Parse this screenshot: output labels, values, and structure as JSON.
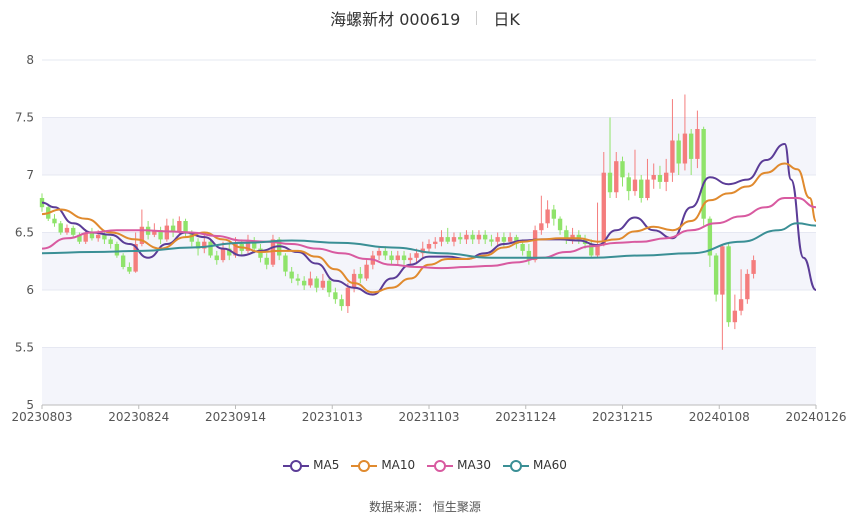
{
  "header": {
    "stock": "海螺新材 000619",
    "period": "日K"
  },
  "source": "数据来源： 恒生聚源",
  "colors": {
    "up": "#f47d7d",
    "down": "#8fe36a",
    "grid_band": "#f4f5fb",
    "ma5": "#5b3c97",
    "ma10": "#e08a2e",
    "ma30": "#d85aa0",
    "ma60": "#3a8f95"
  },
  "chart_data": {
    "type": "candlestick",
    "title": "海螺新材 000619 日K",
    "ylim": [
      5,
      8
    ],
    "y_ticks": [
      "5",
      "5.5",
      "6",
      "6.5",
      "7",
      "7.5",
      "8"
    ],
    "x_ticks": [
      "20230803",
      "20230824",
      "20230914",
      "20231013",
      "20231103",
      "20231124",
      "20231215",
      "20240108",
      "20240126"
    ],
    "trading_days": 119,
    "legend_position": "bottom",
    "series": [
      {
        "name": "MA5",
        "color": "#5b3c97",
        "points": [
          [
            0,
            6.76
          ],
          [
            2,
            6.72
          ],
          [
            5,
            6.58
          ],
          [
            8,
            6.5
          ],
          [
            11,
            6.48
          ],
          [
            14,
            6.4
          ],
          [
            17,
            6.28
          ],
          [
            20,
            6.4
          ],
          [
            23,
            6.5
          ],
          [
            26,
            6.46
          ],
          [
            29,
            6.36
          ],
          [
            32,
            6.3
          ],
          [
            35,
            6.34
          ],
          [
            38,
            6.38
          ],
          [
            41,
            6.33
          ],
          [
            44,
            6.23
          ],
          [
            47,
            6.08
          ],
          [
            50,
            6.02
          ],
          [
            53,
            5.96
          ],
          [
            56,
            6.1
          ],
          [
            59,
            6.22
          ],
          [
            62,
            6.29
          ],
          [
            65,
            6.29
          ],
          [
            68,
            6.27
          ],
          [
            71,
            6.32
          ],
          [
            74,
            6.4
          ],
          [
            77,
            6.43
          ],
          [
            80,
            6.44
          ],
          [
            83,
            6.44
          ],
          [
            86,
            6.43
          ],
          [
            89,
            6.39
          ],
          [
            92,
            6.52
          ],
          [
            95,
            6.63
          ],
          [
            98,
            6.52
          ],
          [
            101,
            6.45
          ],
          [
            104,
            6.72
          ],
          [
            107,
            6.98
          ],
          [
            110,
            6.92
          ],
          [
            113,
            6.96
          ],
          [
            116,
            7.13
          ],
          [
            119,
            7.27
          ],
          [
            120,
            6.96
          ],
          [
            122,
            6.28
          ],
          [
            124,
            6.0
          ]
        ]
      },
      {
        "name": "MA10",
        "color": "#e08a2e",
        "points": [
          [
            0,
            6.66
          ],
          [
            3,
            6.7
          ],
          [
            7,
            6.62
          ],
          [
            11,
            6.5
          ],
          [
            15,
            6.44
          ],
          [
            19,
            6.36
          ],
          [
            23,
            6.46
          ],
          [
            26,
            6.5
          ],
          [
            29,
            6.44
          ],
          [
            32,
            6.37
          ],
          [
            35,
            6.33
          ],
          [
            38,
            6.34
          ],
          [
            41,
            6.34
          ],
          [
            44,
            6.29
          ],
          [
            47,
            6.18
          ],
          [
            50,
            6.06
          ],
          [
            53,
            5.98
          ],
          [
            56,
            6.02
          ],
          [
            59,
            6.1
          ],
          [
            62,
            6.22
          ],
          [
            65,
            6.27
          ],
          [
            68,
            6.27
          ],
          [
            71,
            6.3
          ],
          [
            74,
            6.37
          ],
          [
            77,
            6.42
          ],
          [
            80,
            6.44
          ],
          [
            83,
            6.45
          ],
          [
            86,
            6.45
          ],
          [
            89,
            6.42
          ],
          [
            92,
            6.44
          ],
          [
            95,
            6.51
          ],
          [
            98,
            6.55
          ],
          [
            101,
            6.52
          ],
          [
            104,
            6.6
          ],
          [
            107,
            6.78
          ],
          [
            110,
            6.84
          ],
          [
            113,
            6.9
          ],
          [
            116,
            7.02
          ],
          [
            119,
            7.1
          ],
          [
            121,
            7.05
          ],
          [
            123,
            6.8
          ],
          [
            124,
            6.6
          ]
        ]
      },
      {
        "name": "MA30",
        "color": "#d85aa0",
        "points": [
          [
            0,
            6.36
          ],
          [
            4,
            6.45
          ],
          [
            8,
            6.5
          ],
          [
            12,
            6.52
          ],
          [
            16,
            6.52
          ],
          [
            20,
            6.51
          ],
          [
            24,
            6.5
          ],
          [
            28,
            6.47
          ],
          [
            32,
            6.43
          ],
          [
            36,
            6.42
          ],
          [
            40,
            6.4
          ],
          [
            44,
            6.36
          ],
          [
            48,
            6.32
          ],
          [
            52,
            6.27
          ],
          [
            56,
            6.22
          ],
          [
            60,
            6.2
          ],
          [
            64,
            6.19
          ],
          [
            68,
            6.2
          ],
          [
            72,
            6.21
          ],
          [
            76,
            6.24
          ],
          [
            80,
            6.28
          ],
          [
            84,
            6.33
          ],
          [
            88,
            6.38
          ],
          [
            92,
            6.41
          ],
          [
            96,
            6.42
          ],
          [
            100,
            6.45
          ],
          [
            104,
            6.52
          ],
          [
            108,
            6.58
          ],
          [
            112,
            6.64
          ],
          [
            116,
            6.72
          ],
          [
            119,
            6.8
          ],
          [
            121,
            6.8
          ],
          [
            124,
            6.72
          ]
        ]
      },
      {
        "name": "MA60",
        "color": "#3a8f95",
        "points": [
          [
            0,
            6.32
          ],
          [
            8,
            6.33
          ],
          [
            16,
            6.34
          ],
          [
            24,
            6.37
          ],
          [
            32,
            6.41
          ],
          [
            40,
            6.43
          ],
          [
            48,
            6.41
          ],
          [
            56,
            6.37
          ],
          [
            64,
            6.32
          ],
          [
            72,
            6.28
          ],
          [
            80,
            6.28
          ],
          [
            88,
            6.28
          ],
          [
            96,
            6.3
          ],
          [
            104,
            6.32
          ],
          [
            112,
            6.42
          ],
          [
            118,
            6.52
          ],
          [
            121,
            6.58
          ],
          [
            124,
            6.56
          ]
        ]
      }
    ],
    "candles": [
      [
        6.8,
        6.72,
        6.84,
        6.68
      ],
      [
        6.72,
        6.62,
        6.75,
        6.6
      ],
      [
        6.62,
        6.58,
        6.66,
        6.55
      ],
      [
        6.58,
        6.5,
        6.6,
        6.48
      ],
      [
        6.5,
        6.54,
        6.57,
        6.48
      ],
      [
        6.54,
        6.48,
        6.56,
        6.45
      ],
      [
        6.48,
        6.42,
        6.5,
        6.4
      ],
      [
        6.42,
        6.5,
        6.53,
        6.4
      ],
      [
        6.5,
        6.45,
        6.54,
        6.43
      ],
      [
        6.45,
        6.48,
        6.52,
        6.42
      ],
      [
        6.48,
        6.44,
        6.5,
        6.4
      ],
      [
        6.44,
        6.4,
        6.46,
        6.36
      ],
      [
        6.4,
        6.3,
        6.42,
        6.28
      ],
      [
        6.3,
        6.2,
        6.32,
        6.18
      ],
      [
        6.2,
        6.16,
        6.24,
        6.14
      ],
      [
        6.16,
        6.4,
        6.5,
        6.15
      ],
      [
        6.4,
        6.55,
        6.7,
        6.38
      ],
      [
        6.55,
        6.48,
        6.6,
        6.44
      ],
      [
        6.48,
        6.52,
        6.58,
        6.46
      ],
      [
        6.52,
        6.44,
        6.55,
        6.4
      ],
      [
        6.44,
        6.56,
        6.62,
        6.42
      ],
      [
        6.56,
        6.5,
        6.62,
        6.46
      ],
      [
        6.5,
        6.6,
        6.64,
        6.48
      ],
      [
        6.6,
        6.5,
        6.62,
        6.46
      ],
      [
        6.5,
        6.42,
        6.52,
        6.38
      ],
      [
        6.42,
        6.36,
        6.45,
        6.3
      ],
      [
        6.36,
        6.42,
        6.48,
        6.32
      ],
      [
        6.42,
        6.3,
        6.44,
        6.28
      ],
      [
        6.3,
        6.26,
        6.34,
        6.22
      ],
      [
        6.26,
        6.36,
        6.42,
        6.24
      ],
      [
        6.36,
        6.3,
        6.4,
        6.26
      ],
      [
        6.3,
        6.4,
        6.46,
        6.28
      ],
      [
        6.4,
        6.34,
        6.44,
        6.3
      ],
      [
        6.34,
        6.42,
        6.48,
        6.32
      ],
      [
        6.42,
        6.36,
        6.46,
        6.32
      ],
      [
        6.36,
        6.28,
        6.4,
        6.24
      ],
      [
        6.28,
        6.22,
        6.32,
        6.18
      ],
      [
        6.22,
        6.44,
        6.48,
        6.2
      ],
      [
        6.44,
        6.3,
        6.46,
        6.26
      ],
      [
        6.3,
        6.16,
        6.32,
        6.12
      ],
      [
        6.16,
        6.1,
        6.2,
        6.06
      ],
      [
        6.1,
        6.08,
        6.14,
        6.04
      ],
      [
        6.08,
        6.04,
        6.12,
        6.0
      ],
      [
        6.04,
        6.1,
        6.16,
        6.02
      ],
      [
        6.1,
        6.02,
        6.12,
        5.98
      ],
      [
        6.02,
        6.08,
        6.14,
        6.0
      ],
      [
        6.08,
        5.98,
        6.1,
        5.94
      ],
      [
        5.98,
        5.92,
        6.02,
        5.88
      ],
      [
        5.92,
        5.86,
        5.96,
        5.82
      ],
      [
        5.86,
        6.02,
        6.06,
        5.8
      ],
      [
        6.02,
        6.14,
        6.18,
        5.98
      ],
      [
        6.14,
        6.1,
        6.2,
        6.06
      ],
      [
        6.1,
        6.22,
        6.26,
        6.08
      ],
      [
        6.22,
        6.3,
        6.34,
        6.18
      ],
      [
        6.3,
        6.34,
        6.38,
        6.26
      ],
      [
        6.34,
        6.3,
        6.38,
        6.26
      ],
      [
        6.3,
        6.26,
        6.34,
        6.22
      ],
      [
        6.26,
        6.3,
        6.34,
        6.22
      ],
      [
        6.3,
        6.26,
        6.34,
        6.22
      ],
      [
        6.26,
        6.28,
        6.32,
        6.22
      ],
      [
        6.28,
        6.32,
        6.36,
        6.24
      ],
      [
        6.32,
        6.36,
        6.42,
        6.28
      ],
      [
        6.36,
        6.4,
        6.44,
        6.32
      ],
      [
        6.4,
        6.42,
        6.46,
        6.36
      ],
      [
        6.42,
        6.46,
        6.52,
        6.38
      ],
      [
        6.46,
        6.42,
        6.54,
        6.4
      ],
      [
        6.42,
        6.46,
        6.5,
        6.38
      ],
      [
        6.46,
        6.44,
        6.5,
        6.4
      ],
      [
        6.44,
        6.48,
        6.52,
        6.4
      ],
      [
        6.48,
        6.44,
        6.52,
        6.4
      ],
      [
        6.44,
        6.48,
        6.52,
        6.4
      ],
      [
        6.48,
        6.44,
        6.52,
        6.4
      ],
      [
        6.44,
        6.42,
        6.48,
        6.38
      ],
      [
        6.42,
        6.46,
        6.5,
        6.38
      ],
      [
        6.46,
        6.42,
        6.5,
        6.38
      ],
      [
        6.42,
        6.46,
        6.5,
        6.4
      ],
      [
        6.46,
        6.4,
        6.48,
        6.36
      ],
      [
        6.4,
        6.34,
        6.44,
        6.3
      ],
      [
        6.34,
        6.26,
        6.4,
        6.22
      ],
      [
        6.26,
        6.52,
        6.56,
        6.24
      ],
      [
        6.52,
        6.58,
        6.82,
        6.48
      ],
      [
        6.58,
        6.7,
        6.78,
        6.54
      ],
      [
        6.7,
        6.62,
        6.74,
        6.56
      ],
      [
        6.62,
        6.52,
        6.64,
        6.48
      ],
      [
        6.52,
        6.44,
        6.56,
        6.4
      ],
      [
        6.44,
        6.48,
        6.54,
        6.4
      ],
      [
        6.48,
        6.44,
        6.52,
        6.4
      ],
      [
        6.44,
        6.4,
        6.48,
        6.36
      ],
      [
        6.4,
        6.3,
        6.44,
        6.28
      ],
      [
        6.3,
        6.4,
        6.76,
        6.28
      ],
      [
        6.4,
        7.02,
        7.2,
        6.38
      ],
      [
        7.02,
        6.85,
        7.5,
        6.8
      ],
      [
        6.85,
        7.12,
        7.2,
        6.8
      ],
      [
        7.12,
        6.98,
        7.16,
        6.9
      ],
      [
        6.98,
        6.86,
        7.02,
        6.78
      ],
      [
        6.86,
        6.96,
        7.22,
        6.82
      ],
      [
        6.96,
        6.8,
        7.0,
        6.76
      ],
      [
        6.8,
        6.96,
        7.14,
        6.78
      ],
      [
        6.96,
        7.0,
        7.1,
        6.88
      ],
      [
        7.0,
        6.94,
        7.08,
        6.88
      ],
      [
        6.94,
        7.02,
        7.14,
        6.86
      ],
      [
        7.02,
        7.3,
        7.66,
        6.94
      ],
      [
        7.3,
        7.1,
        7.36,
        7.0
      ],
      [
        7.1,
        7.36,
        7.7,
        7.04
      ],
      [
        7.36,
        7.14,
        7.4,
        7.0
      ],
      [
        7.14,
        7.4,
        7.56,
        7.06
      ],
      [
        7.4,
        6.62,
        7.42,
        6.56
      ],
      [
        6.62,
        6.3,
        6.64,
        6.2
      ],
      [
        6.3,
        5.96,
        6.32,
        5.9
      ],
      [
        5.96,
        6.38,
        6.4,
        5.48
      ],
      [
        6.38,
        5.72,
        6.4,
        5.68
      ],
      [
        5.72,
        5.82,
        5.96,
        5.66
      ],
      [
        5.82,
        5.92,
        6.18,
        5.78
      ],
      [
        5.92,
        6.14,
        6.18,
        5.88
      ],
      [
        6.14,
        6.26,
        6.3,
        6.1
      ]
    ]
  }
}
